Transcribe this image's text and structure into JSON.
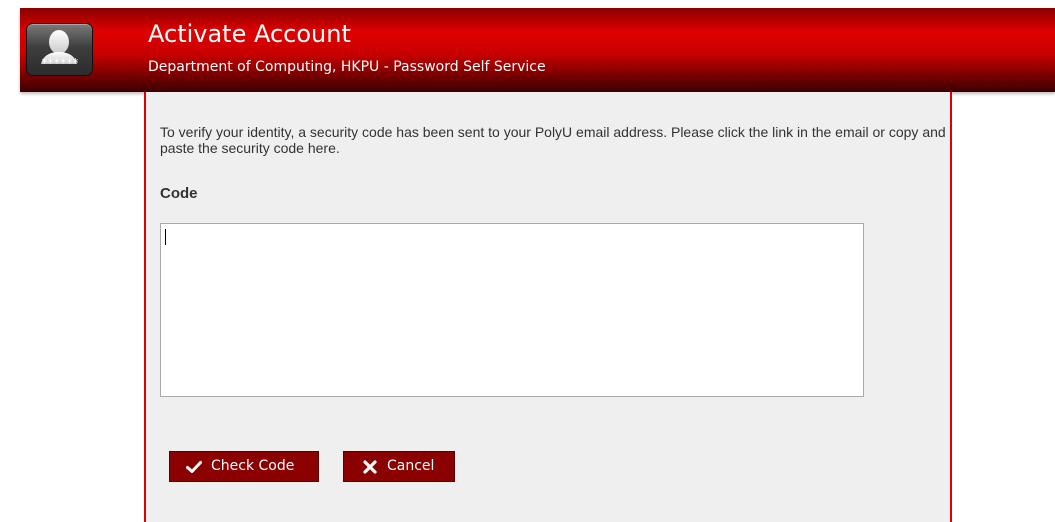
{
  "header": {
    "title": "Activate Account",
    "subtitle": "Department of Computing, HKPU - Password Self Service",
    "logo": {
      "icon": "user-silhouette-icon",
      "masked_text": "******"
    }
  },
  "main": {
    "instructions": "To verify your identity, a security code has been sent to your PolyU email address. Please click the link in the email or copy and paste the security code here.",
    "code_label": "Code",
    "code_value": "",
    "buttons": {
      "check_label": "Check Code",
      "check_icon": "checkmark-icon",
      "cancel_label": "Cancel",
      "cancel_icon": "close-x-icon"
    }
  },
  "colors": {
    "accent": "#cc0000",
    "button": "#8b0000",
    "panel_background": "#efefef",
    "panel_border": "#dd0000"
  }
}
